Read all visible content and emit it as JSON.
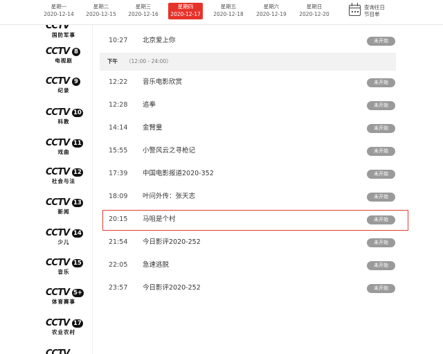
{
  "date_tabs": [
    {
      "weekday": "星期一",
      "date": "2020-12-14",
      "active": false
    },
    {
      "weekday": "星期二",
      "date": "2020-12-15",
      "active": false
    },
    {
      "weekday": "星期三",
      "date": "2020-12-16",
      "active": false
    },
    {
      "weekday": "星期四",
      "date": "2020-12-17",
      "active": true
    },
    {
      "weekday": "星期五",
      "date": "2020-12-18",
      "active": false
    },
    {
      "weekday": "星期六",
      "date": "2020-12-19",
      "active": false
    },
    {
      "weekday": "星期日",
      "date": "2020-12-20",
      "active": false
    }
  ],
  "query": {
    "line1": "查询往日",
    "line2": "节目单",
    "icon": "calendar-icon"
  },
  "channels": [
    {
      "brand": "CCTV",
      "number": "",
      "name": "国防军事"
    },
    {
      "brand": "CCTV",
      "number": "8",
      "name": "电视剧"
    },
    {
      "brand": "CCTV",
      "number": "9",
      "name": "纪录"
    },
    {
      "brand": "CCTV",
      "number": "10",
      "name": "科教"
    },
    {
      "brand": "CCTV",
      "number": "11",
      "name": "戏曲"
    },
    {
      "brand": "CCTV",
      "number": "12",
      "name": "社会与法"
    },
    {
      "brand": "CCTV",
      "number": "13",
      "name": "新闻"
    },
    {
      "brand": "CCTV",
      "number": "14",
      "name": "少儿"
    },
    {
      "brand": "CCTV",
      "number": "15",
      "name": "音乐"
    },
    {
      "brand": "CCTV",
      "number": "5+",
      "name": "体育赛事"
    },
    {
      "brand": "CCTV",
      "number": "17",
      "name": "农业农村"
    },
    {
      "brand": "CCTV",
      "number": "",
      "name": ""
    }
  ],
  "section": {
    "label": "下午",
    "range": "（12:00 - 24:00）"
  },
  "programs_morning": [
    {
      "time": "10:27",
      "title": "北京爱上你",
      "status": "未开始"
    }
  ],
  "programs_afternoon": [
    {
      "time": "12:22",
      "title": "音乐电影欣赏",
      "status": "未开始"
    },
    {
      "time": "12:28",
      "title": "追拳",
      "status": "未开始"
    },
    {
      "time": "14:14",
      "title": "金臂童",
      "status": "未开始"
    },
    {
      "time": "15:55",
      "title": "小警风云之寻枪记",
      "status": "未开始"
    },
    {
      "time": "17:39",
      "title": "中国电影报道2020-352",
      "status": "未开始"
    },
    {
      "time": "18:09",
      "title": "叶问外传：张天志",
      "status": "未开始"
    },
    {
      "time": "20:15",
      "title": "马咀是个村",
      "status": "未开始"
    },
    {
      "time": "21:54",
      "title": "今日影评2020-252",
      "status": "未开始"
    },
    {
      "time": "22:05",
      "title": "急速逃脱",
      "status": "未开始"
    },
    {
      "time": "23:57",
      "title": "今日影评2020-252",
      "status": "未开始"
    }
  ],
  "colors": {
    "accent": "#e6332a",
    "badge": "#9a9a9a",
    "highlight_border": "#e03c31"
  }
}
